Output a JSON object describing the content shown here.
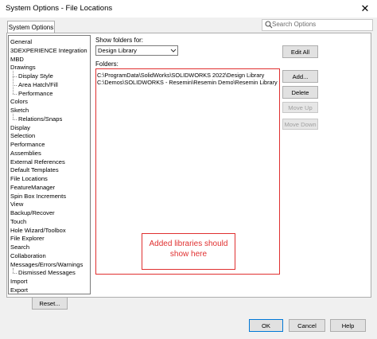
{
  "window": {
    "title": "System Options - File Locations",
    "close_glyph": "✕"
  },
  "tab": {
    "label": "System Options"
  },
  "search": {
    "placeholder": "Search Options"
  },
  "tree": [
    {
      "label": "General",
      "indent": 0
    },
    {
      "label": "3DEXPERIENCE Integration",
      "indent": 0
    },
    {
      "label": "MBD",
      "indent": 0
    },
    {
      "label": "Drawings",
      "indent": 0
    },
    {
      "label": "Display Style",
      "indent": 1
    },
    {
      "label": "Area Hatch/Fill",
      "indent": 1
    },
    {
      "label": "Performance",
      "indent": 1
    },
    {
      "label": "Colors",
      "indent": 0
    },
    {
      "label": "Sketch",
      "indent": 0
    },
    {
      "label": "Relations/Snaps",
      "indent": 1
    },
    {
      "label": "Display",
      "indent": 0
    },
    {
      "label": "Selection",
      "indent": 0
    },
    {
      "label": "Performance",
      "indent": 0
    },
    {
      "label": "Assemblies",
      "indent": 0
    },
    {
      "label": "External References",
      "indent": 0
    },
    {
      "label": "Default Templates",
      "indent": 0
    },
    {
      "label": "File Locations",
      "indent": 0
    },
    {
      "label": "FeatureManager",
      "indent": 0
    },
    {
      "label": "Spin Box Increments",
      "indent": 0
    },
    {
      "label": "View",
      "indent": 0
    },
    {
      "label": "Backup/Recover",
      "indent": 0
    },
    {
      "label": "Touch",
      "indent": 0
    },
    {
      "label": "Hole Wizard/Toolbox",
      "indent": 0
    },
    {
      "label": "File Explorer",
      "indent": 0
    },
    {
      "label": "Search",
      "indent": 0
    },
    {
      "label": "Collaboration",
      "indent": 0
    },
    {
      "label": "Messages/Errors/Warnings",
      "indent": 0
    },
    {
      "label": "Dismissed Messages",
      "indent": 1
    },
    {
      "label": "Import",
      "indent": 0
    },
    {
      "label": "Export",
      "indent": 0
    }
  ],
  "show_folders_label": "Show folders for:",
  "show_folders_value": "Design Library",
  "folders_label": "Folders:",
  "folder_paths": [
    "C:\\ProgramData\\SolidWorks\\SOLIDWORKS 2022\\Design Library",
    "C:\\Demos\\SOLIDWORKS - Resemin\\Resemin Demo\\Resemin Library"
  ],
  "buttons": {
    "edit_all": "Edit All",
    "add": "Add...",
    "delete": "Delete",
    "move_up": "Move Up",
    "move_down": "Move Down",
    "reset": "Reset...",
    "ok": "OK",
    "cancel": "Cancel",
    "help": "Help"
  },
  "annotation": "Added libraries should show here",
  "colors": {
    "annotation_red": "#e03030",
    "primary_border": "#0078d7"
  }
}
